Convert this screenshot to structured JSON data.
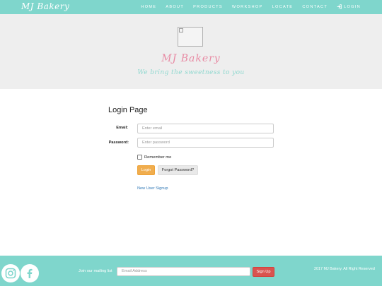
{
  "navbar": {
    "brand": "MJ Bakery",
    "items": [
      {
        "label": "HOME"
      },
      {
        "label": "ABOUT"
      },
      {
        "label": "PRODUCTS"
      },
      {
        "label": "WORKSHOP"
      },
      {
        "label": "LOCATE"
      },
      {
        "label": "CONTACT"
      },
      {
        "label": "LOGIN",
        "icon": "login-icon"
      }
    ]
  },
  "hero": {
    "title": "MJ Bakery",
    "subtitle": "We bring the sweetness to you",
    "image_icon": "broken-image-icon"
  },
  "login": {
    "title": "Login Page",
    "email_label": "Email:",
    "email_placeholder": "Enter email",
    "password_label": "Password:",
    "password_placeholder": "Enter password",
    "remember_label": "Remember me",
    "login_button": "Login",
    "forgot_button": "Forgot Password?",
    "signup_link": "New User Signup"
  },
  "footer": {
    "social": [
      {
        "icon": "instagram-icon"
      },
      {
        "icon": "facebook-icon"
      }
    ],
    "mailing_label": "Join our mailing list",
    "email_placeholder": "Email Address",
    "signup_button": "Sign Up",
    "copyright": "2017 MJ Bakery. All Right Reserved"
  },
  "colors": {
    "accent": "#7fd6cc",
    "hero_bg": "#eeeeee",
    "title_pink": "#e88ba4",
    "login_orange": "#f0ad4e",
    "signup_red": "#d9534f",
    "link_blue": "#337ab7"
  }
}
